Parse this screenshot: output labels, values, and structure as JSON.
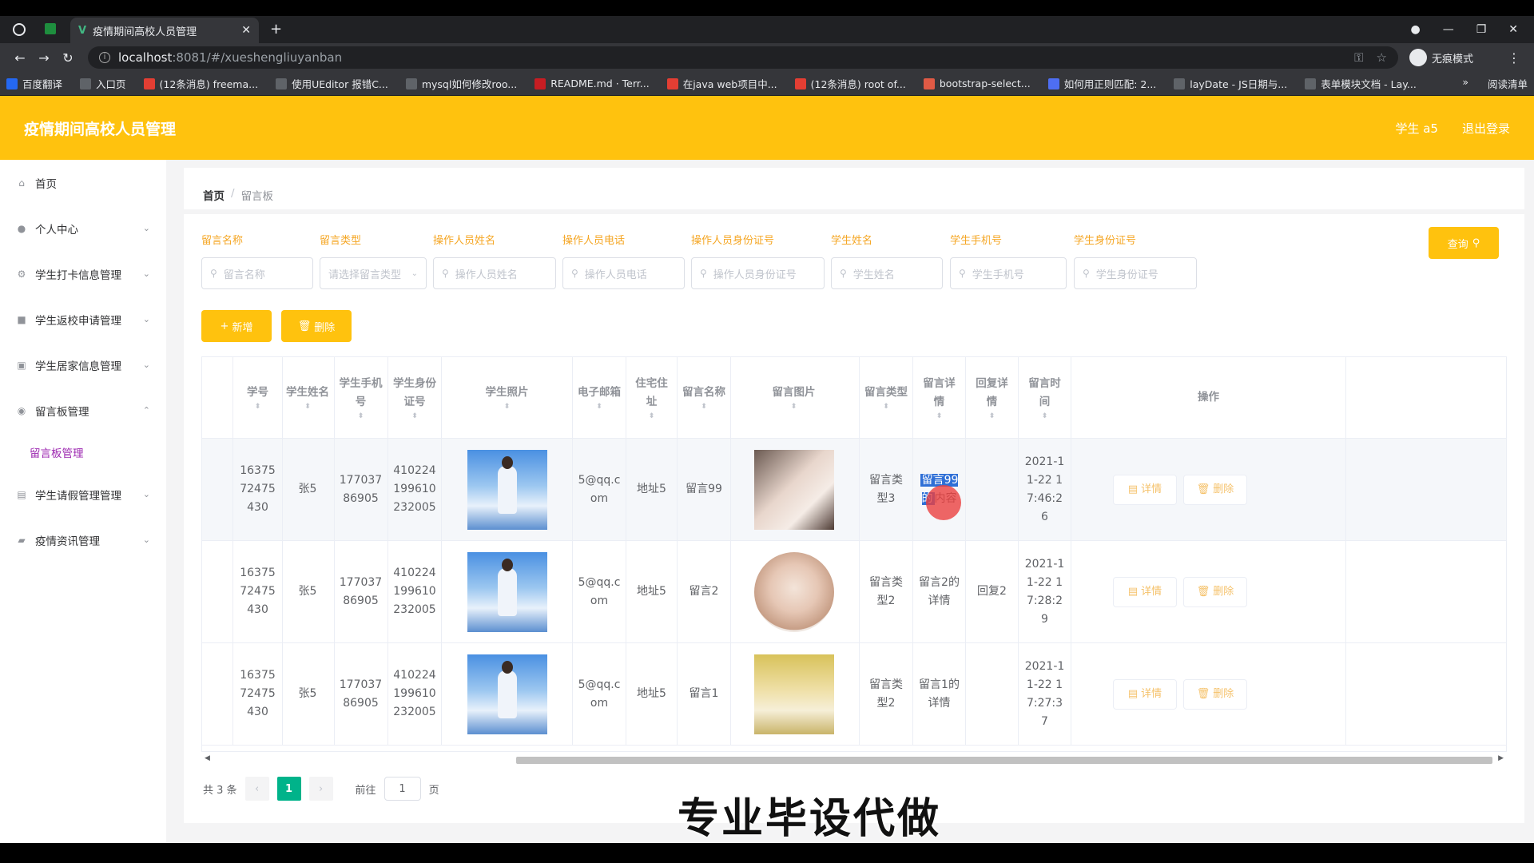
{
  "browser": {
    "tab_title": "疫情期间高校人员管理",
    "url_host": "localhost",
    "url_path": ":8081/#/xueshengliuyanban",
    "incognito_label": "无痕模式",
    "bookmarks": [
      {
        "label": "百度翻译",
        "color": "#2468f2"
      },
      {
        "label": "入口页",
        "color": "#5f6368"
      },
      {
        "label": "(12条消息) freema...",
        "color": "#e33e33"
      },
      {
        "label": "使用UEditor 报错C...",
        "color": "#5f6368"
      },
      {
        "label": "mysql如何修改roo...",
        "color": "#5f6368"
      },
      {
        "label": "README.md · Terr...",
        "color": "#c71d23"
      },
      {
        "label": "在java web项目中...",
        "color": "#e33e33"
      },
      {
        "label": "(12条消息) root of...",
        "color": "#e33e33"
      },
      {
        "label": "bootstrap-select...",
        "color": "#e05a45"
      },
      {
        "label": "如何用正则匹配: 2...",
        "color": "#4e6ef2"
      },
      {
        "label": "layDate - JS日期与...",
        "color": "#5f6368"
      },
      {
        "label": "表单模块文档 - Lay...",
        "color": "#5f6368"
      }
    ],
    "reading_list": "阅读清单"
  },
  "app": {
    "title": "疫情期间高校人员管理",
    "user_label": "学生 a5",
    "logout_label": "退出登录"
  },
  "sidebar": {
    "items": [
      {
        "label": "首页",
        "icon": "home-icon",
        "glyph": "⌂"
      },
      {
        "label": "个人中心",
        "icon": "user-icon",
        "glyph": "●"
      },
      {
        "label": "学生打卡信息管理",
        "icon": "settings-icon",
        "glyph": "⚙"
      },
      {
        "label": "学生返校申请管理",
        "icon": "briefcase-icon",
        "glyph": "■"
      },
      {
        "label": "学生居家信息管理",
        "icon": "chart-icon",
        "glyph": "▣"
      },
      {
        "label": "留言板管理",
        "icon": "location-icon",
        "glyph": "◉"
      },
      {
        "label": "学生请假管理管理",
        "icon": "clipboard-icon",
        "glyph": "▤"
      },
      {
        "label": "疫情资讯管理",
        "icon": "folder-icon",
        "glyph": "▰"
      }
    ],
    "active_sub": "留言板管理"
  },
  "breadcrumb": {
    "home": "首页",
    "current": "留言板"
  },
  "filters": [
    {
      "label": "留言名称",
      "placeholder": "留言名称"
    },
    {
      "label": "留言类型",
      "placeholder": "请选择留言类型"
    },
    {
      "label": "操作人员姓名",
      "placeholder": "操作人员姓名"
    },
    {
      "label": "操作人员电话",
      "placeholder": "操作人员电话"
    },
    {
      "label": "操作人员身份证号",
      "placeholder": "操作人员身份证号"
    },
    {
      "label": "学生姓名",
      "placeholder": "学生姓名"
    },
    {
      "label": "学生手机号",
      "placeholder": "学生手机号"
    },
    {
      "label": "学生身份证号",
      "placeholder": "学生身份证号"
    }
  ],
  "buttons": {
    "query": "查询",
    "add": "新增",
    "delete": "删除",
    "detail": "详情",
    "row_delete": "删除"
  },
  "table": {
    "headers": [
      "学号",
      "学生姓名",
      "学生手机号",
      "学生身份证号",
      "学生照片",
      "电子邮箱",
      "住宅住址",
      "留言名称",
      "留言图片",
      "留言类型",
      "留言详情",
      "回复详情",
      "留言时间",
      "操作"
    ],
    "rows": [
      {
        "xuehao": "1637572475430",
        "name": "张5",
        "phone": "17703786905",
        "idcard": "410224199610232005",
        "email": "5@qq.com",
        "address": "地址5",
        "msg_name": "留言99",
        "msg_type": "留言类型3",
        "detail_hl": "留言99的",
        "detail_rest": "内容",
        "reply": "",
        "time": "2021-11-22 17:46:26"
      },
      {
        "xuehao": "1637572475430",
        "name": "张5",
        "phone": "17703786905",
        "idcard": "410224199610232005",
        "email": "5@qq.com",
        "address": "地址5",
        "msg_name": "留言2",
        "msg_type": "留言类型2",
        "detail_hl": "",
        "detail_rest": "留言2的详情",
        "reply": "回复2",
        "time": "2021-11-22 17:28:29"
      },
      {
        "xuehao": "1637572475430",
        "name": "张5",
        "phone": "17703786905",
        "idcard": "410224199610232005",
        "email": "5@qq.com",
        "address": "地址5",
        "msg_name": "留言1",
        "msg_type": "留言类型2",
        "detail_hl": "",
        "detail_rest": "留言1的详情",
        "reply": "",
        "time": "2021-11-22 17:27:37"
      }
    ]
  },
  "pagination": {
    "total": "共 3 条",
    "current": "1",
    "goto_label": "前往",
    "goto_value": "1",
    "page_suffix": "页"
  },
  "watermark": "专业毕设代做",
  "colors": {
    "accent": "#ffc20e",
    "label": "#f5a623",
    "active_sub": "#9c27b0",
    "page_current": "#00b38a"
  }
}
